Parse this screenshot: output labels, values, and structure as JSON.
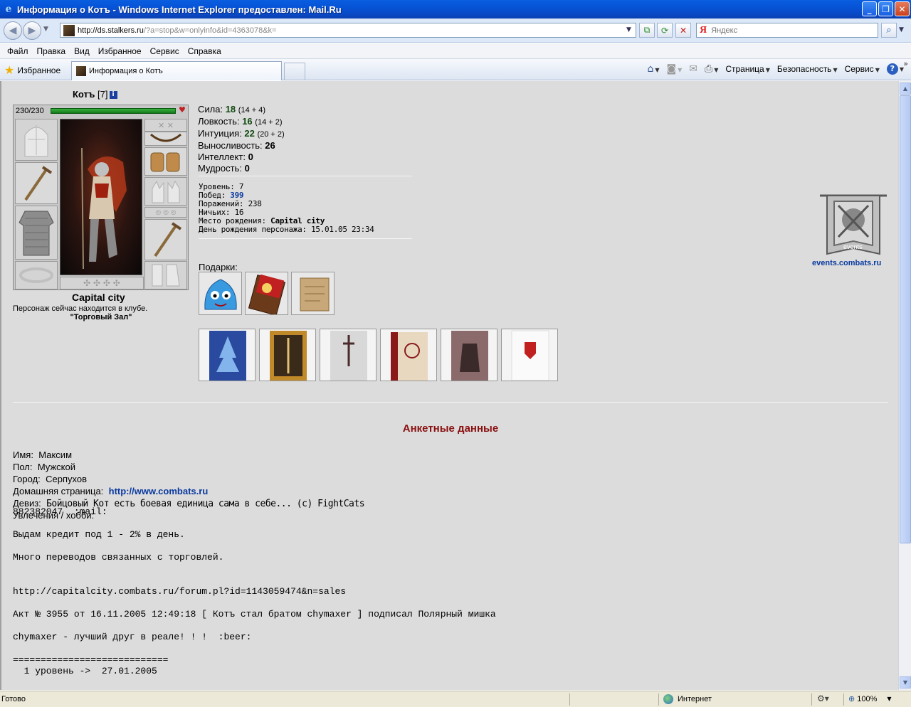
{
  "window": {
    "title": "Информация о Котъ - Windows Internet Explorer предоставлен: Mail.Ru",
    "min": "_",
    "max": "❐",
    "close": "✕"
  },
  "addressbar": {
    "url_host": "http://ds.stalkers.ru",
    "url_path": "/?a=stop&w=onlyinfo&id=4363078&k=",
    "search_placeholder": "Яндекс",
    "search_logo": "Я"
  },
  "menu": [
    "Файл",
    "Правка",
    "Вид",
    "Избранное",
    "Сервис",
    "Справка"
  ],
  "tabs": {
    "favorites_label": "Избранное",
    "active_tab": "Информация о Котъ"
  },
  "commandbar": {
    "page": "Страница",
    "safety": "Безопасность",
    "tools": "Сервис"
  },
  "character": {
    "name": "Котъ",
    "level": "[7]",
    "hp": "230/230",
    "hp_fraction": 1.0,
    "city": "Capital city",
    "location_text": "Персонаж сейчас находится в клубе.",
    "location_place": "\"Торговый Зал\""
  },
  "stats": [
    {
      "label": "Сила:",
      "value": "18",
      "bonus": "(14 + 4)"
    },
    {
      "label": "Ловкость:",
      "value": "16",
      "bonus": "(14 + 2)"
    },
    {
      "label": "Интуиция:",
      "value": "22",
      "bonus": "(20 + 2)"
    },
    {
      "label": "Выносливость:",
      "value": "26",
      "bonus": ""
    },
    {
      "label": "Интеллект:",
      "value": "0",
      "bonus": ""
    },
    {
      "label": "Мудрость:",
      "value": "0",
      "bonus": ""
    }
  ],
  "details": {
    "level_label": "Уровень:",
    "level": "7",
    "wins_label": "Побед:",
    "wins": "399",
    "losses_label": "Поражений:",
    "losses": "238",
    "draws_label": "Ничьих:",
    "draws": "16",
    "birthplace_label": "Место рождения:",
    "birthplace": "Capital city",
    "birthday_label": "День рождения персонажа:",
    "birthday": "15.01.05 23:34"
  },
  "gifts_label": "Подарки:",
  "events": {
    "logo_text": "events",
    "link": "events.combats.ru"
  },
  "profile": {
    "title": "Анкетные данные",
    "name_label": "Имя:",
    "name": "Максим",
    "sex_label": "Пол:",
    "sex": "Мужской",
    "city_label": "Город:",
    "city": "Серпухов",
    "homepage_label": "Домашняя страница:",
    "homepage": "http://www.combats.ru",
    "motto_label": "Девиз:",
    "motto": "Бойцовый Кот есть боевая единица сама в себе... (c) FightCats",
    "hobby_label": "Увлечения / хобби:",
    "about": [
      "882382047  :mail:",
      "",
      "Выдам кредит под 1 - 2% в день.",
      "",
      "Много переводов связанных с торговлей.",
      "",
      "",
      "http://capitalcity.combats.ru/forum.pl?id=1143059474&n=sales",
      "",
      "Акт № 3955 от 16.11.2005 12:49:18 [ Котъ стал братом chymaxer ] подписал Полярный мишка",
      "",
      "chymaxer - лучший друг в реале! ! !  :beer:",
      "",
      "============================",
      "  1 уровень ->  27.01.2005"
    ]
  },
  "statusbar": {
    "status": "Готово",
    "zone": "Интернет",
    "zoom": "100%"
  }
}
